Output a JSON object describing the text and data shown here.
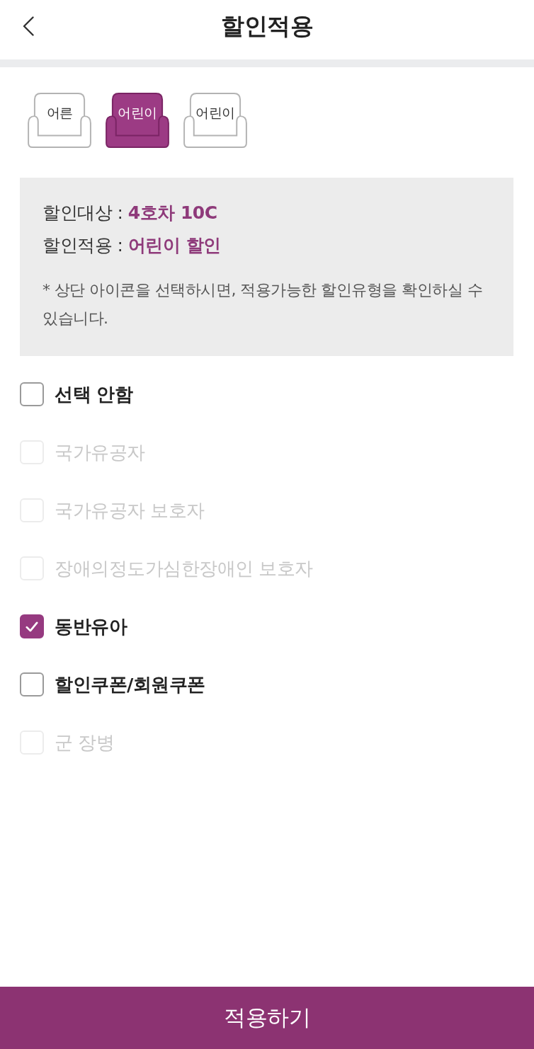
{
  "header": {
    "title": "할인적용"
  },
  "passenger_types": [
    {
      "label": "어른",
      "selected": false
    },
    {
      "label": "어린이",
      "selected": true
    },
    {
      "label": "어린이",
      "selected": false
    }
  ],
  "info": {
    "lines": [
      "할인대상 : **4호차 10C**",
      "할인적용 : **어린이 할인**"
    ],
    "note": "* 상단 아이콘을 선택하시면, 적용가능한 할인유형을 확인하실 수 있습니다."
  },
  "discount_options": [
    {
      "label": "선택 안함",
      "checked": false,
      "disabled": false
    },
    {
      "label": "국가유공자",
      "checked": false,
      "disabled": true
    },
    {
      "label": "국가유공자 보호자",
      "checked": false,
      "disabled": true
    },
    {
      "label": "장애의정도가심한장애인 보호자",
      "checked": false,
      "disabled": true
    },
    {
      "label": "동반유아",
      "checked": true,
      "disabled": false
    },
    {
      "label": "할인쿠폰/회원쿠폰",
      "checked": false,
      "disabled": false
    },
    {
      "label": "군 장병",
      "checked": false,
      "disabled": true
    }
  ],
  "apply_button": {
    "label": "적용하기"
  }
}
